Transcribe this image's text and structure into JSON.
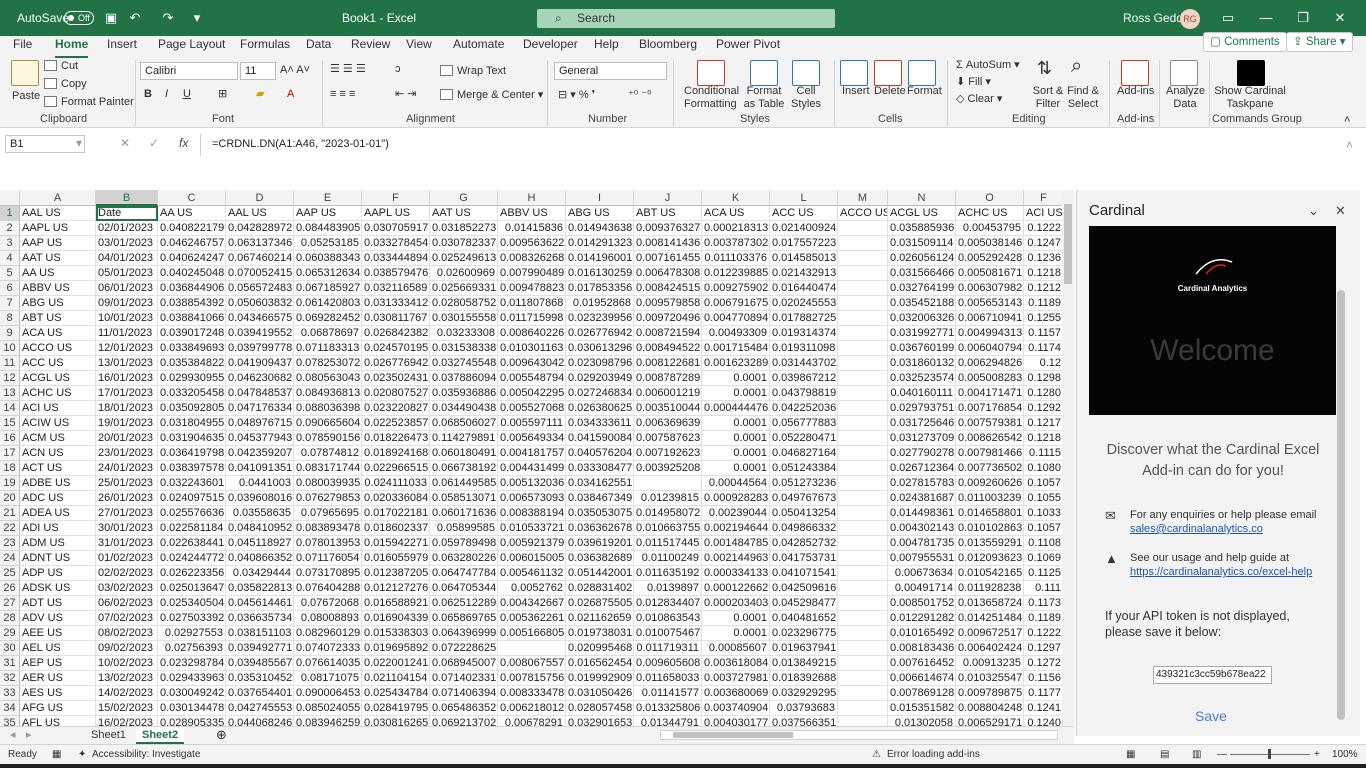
{
  "titlebar": {
    "autosave_label": "AutoSave",
    "autosave_state": "Off",
    "doc_title": "Book1 - Excel",
    "search_placeholder": "Search",
    "user_name": "Ross Geddis",
    "user_initials": "RG"
  },
  "menu": {
    "tabs": [
      "File",
      "Home",
      "Insert",
      "Page Layout",
      "Formulas",
      "Data",
      "Review",
      "View",
      "Automate",
      "Developer",
      "Help",
      "Bloomberg",
      "Power Pivot"
    ],
    "active": "Home",
    "comments_label": "Comments",
    "share_label": "Share"
  },
  "ribbon": {
    "paste": "Paste",
    "cut": "Cut",
    "copy": "Copy",
    "format_painter": "Format Painter",
    "clipboard": "Clipboard",
    "font_name": "Calibri",
    "font_size": "11",
    "font": "Font",
    "wrap_text": "Wrap Text",
    "merge_center": "Merge & Center",
    "alignment": "Alignment",
    "number_format": "General",
    "number": "Number",
    "conditional_formatting": "Conditional Formatting",
    "format_as_table": "Format as Table",
    "cell_styles": "Cell Styles",
    "styles": "Styles",
    "insert": "Insert",
    "delete": "Delete",
    "format": "Format",
    "cells": "Cells",
    "autosum": "AutoSum",
    "fill": "Fill",
    "clear": "Clear",
    "sort_filter": "Sort & Filter",
    "find_select": "Find & Select",
    "editing": "Editing",
    "addins": "Add-ins",
    "addins_group": "Add-ins",
    "analyze_data": "Analyze Data",
    "show_cardinal": "Show Cardinal Taskpane",
    "commands_group": "Commands Group"
  },
  "formula_bar": {
    "name_box": "B1",
    "formula": "=CRDNL.DN(A1:A46, \"2023-01-01\")"
  },
  "sheet": {
    "columns": [
      "A",
      "B",
      "C",
      "D",
      "E",
      "F",
      "G",
      "H",
      "I",
      "J",
      "K",
      "L",
      "M",
      "N",
      "O",
      "F"
    ],
    "header_row": [
      "AAL US",
      "Date",
      "AA US",
      "AAL US",
      "AAP US",
      "AAPL US",
      "AAT US",
      "ABBV US",
      "ABG US",
      "ABT US",
      "ACA US",
      "ACC US",
      "ACCO US",
      "ACGL US",
      "ACHC US",
      "ACI US"
    ],
    "rows": [
      [
        "AAPL US",
        "02/01/2023",
        "0.040822179",
        "0.042828972",
        "0.084483905",
        "0.030705917",
        "0.031852273",
        "0.01415836",
        "0.014943638",
        "0.009376327",
        "0.000218313",
        "0.021400924",
        "",
        "0.035885936",
        "0.00453795",
        "0.1222"
      ],
      [
        "AAP US",
        "03/01/2023",
        "0.046246757",
        "0.063137346",
        "0.05253185",
        "0.033278454",
        "0.030782337",
        "0.009563622",
        "0.014291323",
        "0.008141436",
        "0.003787302",
        "0.017557223",
        "",
        "0.031509114",
        "0.005038146",
        "0.1247"
      ],
      [
        "AAT US",
        "04/01/2023",
        "0.040624247",
        "0.067460214",
        "0.060388343",
        "0.033444894",
        "0.025249613",
        "0.008326268",
        "0.014196001",
        "0.007161455",
        "0.011103376",
        "0.014585013",
        "",
        "0.026056124",
        "0.005292428",
        "0.1236"
      ],
      [
        "AA US",
        "05/01/2023",
        "0.040245048",
        "0.070052415",
        "0.065312634",
        "0.038579476",
        "0.02600969",
        "0.007990489",
        "0.016130259",
        "0.006478308",
        "0.012239885",
        "0.021432913",
        "",
        "0.031566466",
        "0.005081671",
        "0.1218"
      ],
      [
        "ABBV US",
        "06/01/2023",
        "0.036844906",
        "0.056572483",
        "0.067185927",
        "0.032116589",
        "0.025669331",
        "0.009478823",
        "0.017853356",
        "0.008424515",
        "0.009275902",
        "0.016440474",
        "",
        "0.032764199",
        "0.006307982",
        "0.1212"
      ],
      [
        "ABG US",
        "09/01/2023",
        "0.038854392",
        "0.050603832",
        "0.061420803",
        "0.031333412",
        "0.028058752",
        "0.011807868",
        "0.01952868",
        "0.009579858",
        "0.006791675",
        "0.020245553",
        "",
        "0.035452188",
        "0.005653143",
        "0.1189"
      ],
      [
        "ABT US",
        "10/01/2023",
        "0.038841066",
        "0.043466575",
        "0.069282452",
        "0.030811767",
        "0.030155558",
        "0.011715998",
        "0.023239956",
        "0.009720496",
        "0.004770894",
        "0.017882725",
        "",
        "0.032006326",
        "0.006710941",
        "0.1255"
      ],
      [
        "ACA US",
        "11/01/2023",
        "0.039017248",
        "0.039419552",
        "0.06878697",
        "0.026842382",
        "0.03233308",
        "0.008640226",
        "0.026776942",
        "0.008721594",
        "0.00493309",
        "0.019314374",
        "",
        "0.031992771",
        "0.004994313",
        "0.1157"
      ],
      [
        "ACCO US",
        "12/01/2023",
        "0.033849693",
        "0.039799778",
        "0.071183313",
        "0.024570195",
        "0.031538338",
        "0.010301163",
        "0.030613296",
        "0.008494522",
        "0.001715484",
        "0.019311098",
        "",
        "0.036760199",
        "0.006040794",
        "0.1174"
      ],
      [
        "ACC US",
        "13/01/2023",
        "0.035384822",
        "0.041909437",
        "0.078253072",
        "0.026776942",
        "0.032745548",
        "0.009643042",
        "0.023098796",
        "0.008122681",
        "0.001623289",
        "0.031443702",
        "",
        "0.031860132",
        "0.006294826",
        "0.12"
      ],
      [
        "ACGL US",
        "16/01/2023",
        "0.029930955",
        "0.046230682",
        "0.080563043",
        "0.023502431",
        "0.037886094",
        "0.005548794",
        "0.029203949",
        "0.008787289",
        "0.0001",
        "0.039867212",
        "",
        "0.032523574",
        "0.005008283",
        "0.1298"
      ],
      [
        "ACHC US",
        "17/01/2023",
        "0.033205458",
        "0.047848537",
        "0.084936813",
        "0.020807527",
        "0.035936886",
        "0.005042295",
        "0.027246834",
        "0.006001219",
        "0.0001",
        "0.043798819",
        "",
        "0.040160111",
        "0.004171471",
        "0.1280"
      ],
      [
        "ACI US",
        "18/01/2023",
        "0.035092805",
        "0.047176334",
        "0.088036398",
        "0.023220827",
        "0.034490438",
        "0.005527068",
        "0.026380625",
        "0.003510044",
        "0.000444476",
        "0.042252036",
        "",
        "0.029793751",
        "0.007176854",
        "0.1292"
      ],
      [
        "ACIW US",
        "19/01/2023",
        "0.031804955",
        "0.048976715",
        "0.090665604",
        "0.022523857",
        "0.068506027",
        "0.005597111",
        "0.034333611",
        "0.006369639",
        "0.0001",
        "0.056777883",
        "",
        "0.031725646",
        "0.007579381",
        "0.1217"
      ],
      [
        "ACM US",
        "20/01/2023",
        "0.031904635",
        "0.045377943",
        "0.078590156",
        "0.018226473",
        "0.114279891",
        "0.005649334",
        "0.041590084",
        "0.007587623",
        "0.0001",
        "0.052280471",
        "",
        "0.031273709",
        "0.008626542",
        "0.1218"
      ],
      [
        "ACN US",
        "23/01/2023",
        "0.036419798",
        "0.042359207",
        "0.07874812",
        "0.018924168",
        "0.060180491",
        "0.004181757",
        "0.040576204",
        "0.007192623",
        "0.0001",
        "0.046827164",
        "",
        "0.027790278",
        "0.007981466",
        "0.1115"
      ],
      [
        "ACT US",
        "24/01/2023",
        "0.038397578",
        "0.041091351",
        "0.083171744",
        "0.022966515",
        "0.066738192",
        "0.004431499",
        "0.033308477",
        "0.003925208",
        "0.0001",
        "0.051243384",
        "",
        "0.026712364",
        "0.007736502",
        "0.1080"
      ],
      [
        "ADBE US",
        "25/01/2023",
        "0.032243601",
        "0.0441003",
        "0.080039935",
        "0.024111033",
        "0.061449585",
        "0.005132036",
        "0.034162551",
        "",
        "0.00044564",
        "0.051273236",
        "",
        "0.027815783",
        "0.009260626",
        "0.1057"
      ],
      [
        "ADC US",
        "26/01/2023",
        "0.024097515",
        "0.039608016",
        "0.076279853",
        "0.020336084",
        "0.058513071",
        "0.006573093",
        "0.038467349",
        "0.01239815",
        "0.000928283",
        "0.049767673",
        "",
        "0.024381687",
        "0.011003239",
        "0.1055"
      ],
      [
        "ADEA US",
        "27/01/2023",
        "0.025576636",
        "0.03558635",
        "0.07965695",
        "0.017022181",
        "0.060171636",
        "0.008388194",
        "0.035053075",
        "0.014958072",
        "0.00239044",
        "0.050413254",
        "",
        "0.014498361",
        "0.014658801",
        "0.1033"
      ],
      [
        "ADI US",
        "30/01/2023",
        "0.022581184",
        "0.048410952",
        "0.083893478",
        "0.018602337",
        "0.05899585",
        "0.010533721",
        "0.036362678",
        "0.010663755",
        "0.002194644",
        "0.049866332",
        "",
        "0.004302143",
        "0.010102863",
        "0.1057"
      ],
      [
        "ADM US",
        "31/01/2023",
        "0.022638441",
        "0.045118927",
        "0.078013953",
        "0.015942271",
        "0.059789498",
        "0.005921379",
        "0.039619201",
        "0.011517445",
        "0.001484785",
        "0.042852732",
        "",
        "0.004781735",
        "0.013559291",
        "0.1108"
      ],
      [
        "ADNT US",
        "01/02/2023",
        "0.024244772",
        "0.040866352",
        "0.071176054",
        "0.016055979",
        "0.063280226",
        "0.006015005",
        "0.036382689",
        "0.01100249",
        "0.002144963",
        "0.041753731",
        "",
        "0.007955531",
        "0.012093623",
        "0.1069"
      ],
      [
        "ADP US",
        "02/02/2023",
        "0.026223356",
        "0.03429444",
        "0.073170895",
        "0.012387205",
        "0.064747784",
        "0.005461132",
        "0.051442001",
        "0.011635192",
        "0.000334133",
        "0.041071541",
        "",
        "0.00673634",
        "0.010542165",
        "0.1125"
      ],
      [
        "ADSK US",
        "03/02/2023",
        "0.025013647",
        "0.035822813",
        "0.076404288",
        "0.012127276",
        "0.064705344",
        "0.0052762",
        "0.028831402",
        "0.0139897",
        "0.000122662",
        "0.042509616",
        "",
        "0.00491714",
        "0.011928238",
        "0.111"
      ],
      [
        "ADT US",
        "06/02/2023",
        "0.025340504",
        "0.045614461",
        "0.07672068",
        "0.016588921",
        "0.062512289",
        "0.004342667",
        "0.026875505",
        "0.012834407",
        "0.000203403",
        "0.045298477",
        "",
        "0.008501752",
        "0.013658724",
        "0.1173"
      ],
      [
        "ADV US",
        "07/02/2023",
        "0.027503392",
        "0.036635734",
        "0.08008893",
        "0.016904339",
        "0.065869765",
        "0.005362261",
        "0.021162659",
        "0.010863543",
        "0.0001",
        "0.040481652",
        "",
        "0.012291282",
        "0.014251484",
        "0.1189"
      ],
      [
        "AEE US",
        "08/02/2023",
        "0.02927553",
        "0.038151103",
        "0.082960129",
        "0.015338303",
        "0.064396999",
        "0.005166805",
        "0.019738031",
        "0.010075467",
        "0.0001",
        "0.023296775",
        "",
        "0.010165492",
        "0.009672517",
        "0.1222"
      ],
      [
        "AEL US",
        "09/02/2023",
        "0.02756393",
        "0.039492771",
        "0.074072333",
        "0.019695892",
        "0.072228625",
        "",
        "0.020995468",
        "0.011719311",
        "0.00085607",
        "0.019637941",
        "",
        "0.008183436",
        "0.006402424",
        "0.1297"
      ],
      [
        "AEP US",
        "10/02/2023",
        "0.023298784",
        "0.039485567",
        "0.076614035",
        "0.022001241",
        "0.068945007",
        "0.008067557",
        "0.016562454",
        "0.009605608",
        "0.003618084",
        "0.013849215",
        "",
        "0.007616452",
        "0.00913235",
        "0.1272"
      ],
      [
        "AER US",
        "13/02/2023",
        "0.029433963",
        "0.035310452",
        "0.08171075",
        "0.021104154",
        "0.071402331",
        "0.007815756",
        "0.019992909",
        "0.011658033",
        "0.003727981",
        "0.018392688",
        "",
        "0.006614674",
        "0.010325547",
        "0.1156"
      ],
      [
        "AES US",
        "14/02/2023",
        "0.030049242",
        "0.037654401",
        "0.090006453",
        "0.025434784",
        "0.071406394",
        "0.008333478",
        "0.031050426",
        "0.01141577",
        "0.003680069",
        "0.032929295",
        "",
        "0.007869128",
        "0.009789875",
        "0.1177"
      ],
      [
        "AFG US",
        "15/02/2023",
        "0.030134478",
        "0.042745553",
        "0.085024055",
        "0.028419795",
        "0.065486352",
        "0.006218012",
        "0.028057458",
        "0.013325806",
        "0.003740904",
        "0.03793683",
        "",
        "0.015351582",
        "0.008804248",
        "0.1241"
      ],
      [
        "AFL US",
        "16/02/2023",
        "0.028905335",
        "0.044068246",
        "0.083946259",
        "0.030816265",
        "0.069213702",
        "0.00678291",
        "0.032901653",
        "0.01344791",
        "0.004030177",
        "0.037566351",
        "",
        "0.01302058",
        "0.006529171",
        "0.1240"
      ]
    ]
  },
  "sheets": {
    "tabs": [
      "Sheet1",
      "Sheet2"
    ],
    "active": "Sheet2"
  },
  "status": {
    "ready": "Ready",
    "accessibility": "Accessibility: Investigate",
    "addins_error": "Error loading add-ins",
    "zoom": "100%"
  },
  "pane": {
    "title": "Cardinal",
    "brand": "Cardinal Analytics",
    "welcome": "Welcome",
    "discover": "Discover what the Cardinal Excel Add-in can do for you!",
    "email_text": "For any enquiries or help please email",
    "email": "sales@cardinalanalytics.co",
    "guide_text": "See our usage and help guide at",
    "guide_url": "https://cardinalanalytics.co/excel-help",
    "token_text": "If your API token is not displayed, please save it below:",
    "token_value": "439321c3cc59b678ea22",
    "save": "Save"
  },
  "colors": {
    "accent": "#217346",
    "link": "#1a56b0"
  }
}
